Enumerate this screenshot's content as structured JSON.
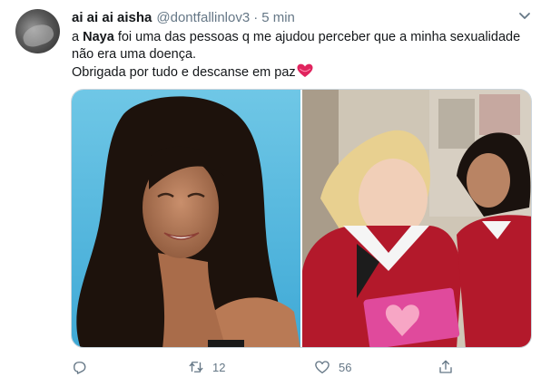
{
  "tweet": {
    "display_name": "ai ai ai aisha",
    "handle": "@dontfallinlov3",
    "separator": "·",
    "timestamp": "5 min",
    "text": {
      "line1_prefix": "a",
      "line1_name": "Naya",
      "line1_rest": "foi uma das pessoas q me ajudou perceber que a minha sexualidade",
      "line2": "não era uma doença.",
      "line3": "Obrigada por tudo e descanse em paz",
      "emoji": "heart-emoji"
    },
    "media": {
      "count": 2,
      "images": [
        "portrait-photo",
        "cheerleaders-photo"
      ]
    },
    "actions": {
      "reply_count": "",
      "retweet_count": "12",
      "like_count": "56"
    }
  },
  "icons": {
    "avatar": "avatar-photo",
    "menu": "chevron-down-icon",
    "reply": "reply-icon",
    "retweet": "retweet-icon",
    "like": "heart-icon",
    "share": "share-icon"
  },
  "colors": {
    "text": "#14171a",
    "secondary": "#657786",
    "border": "#ccd6dd",
    "emoji_heart": "#e0245e"
  }
}
